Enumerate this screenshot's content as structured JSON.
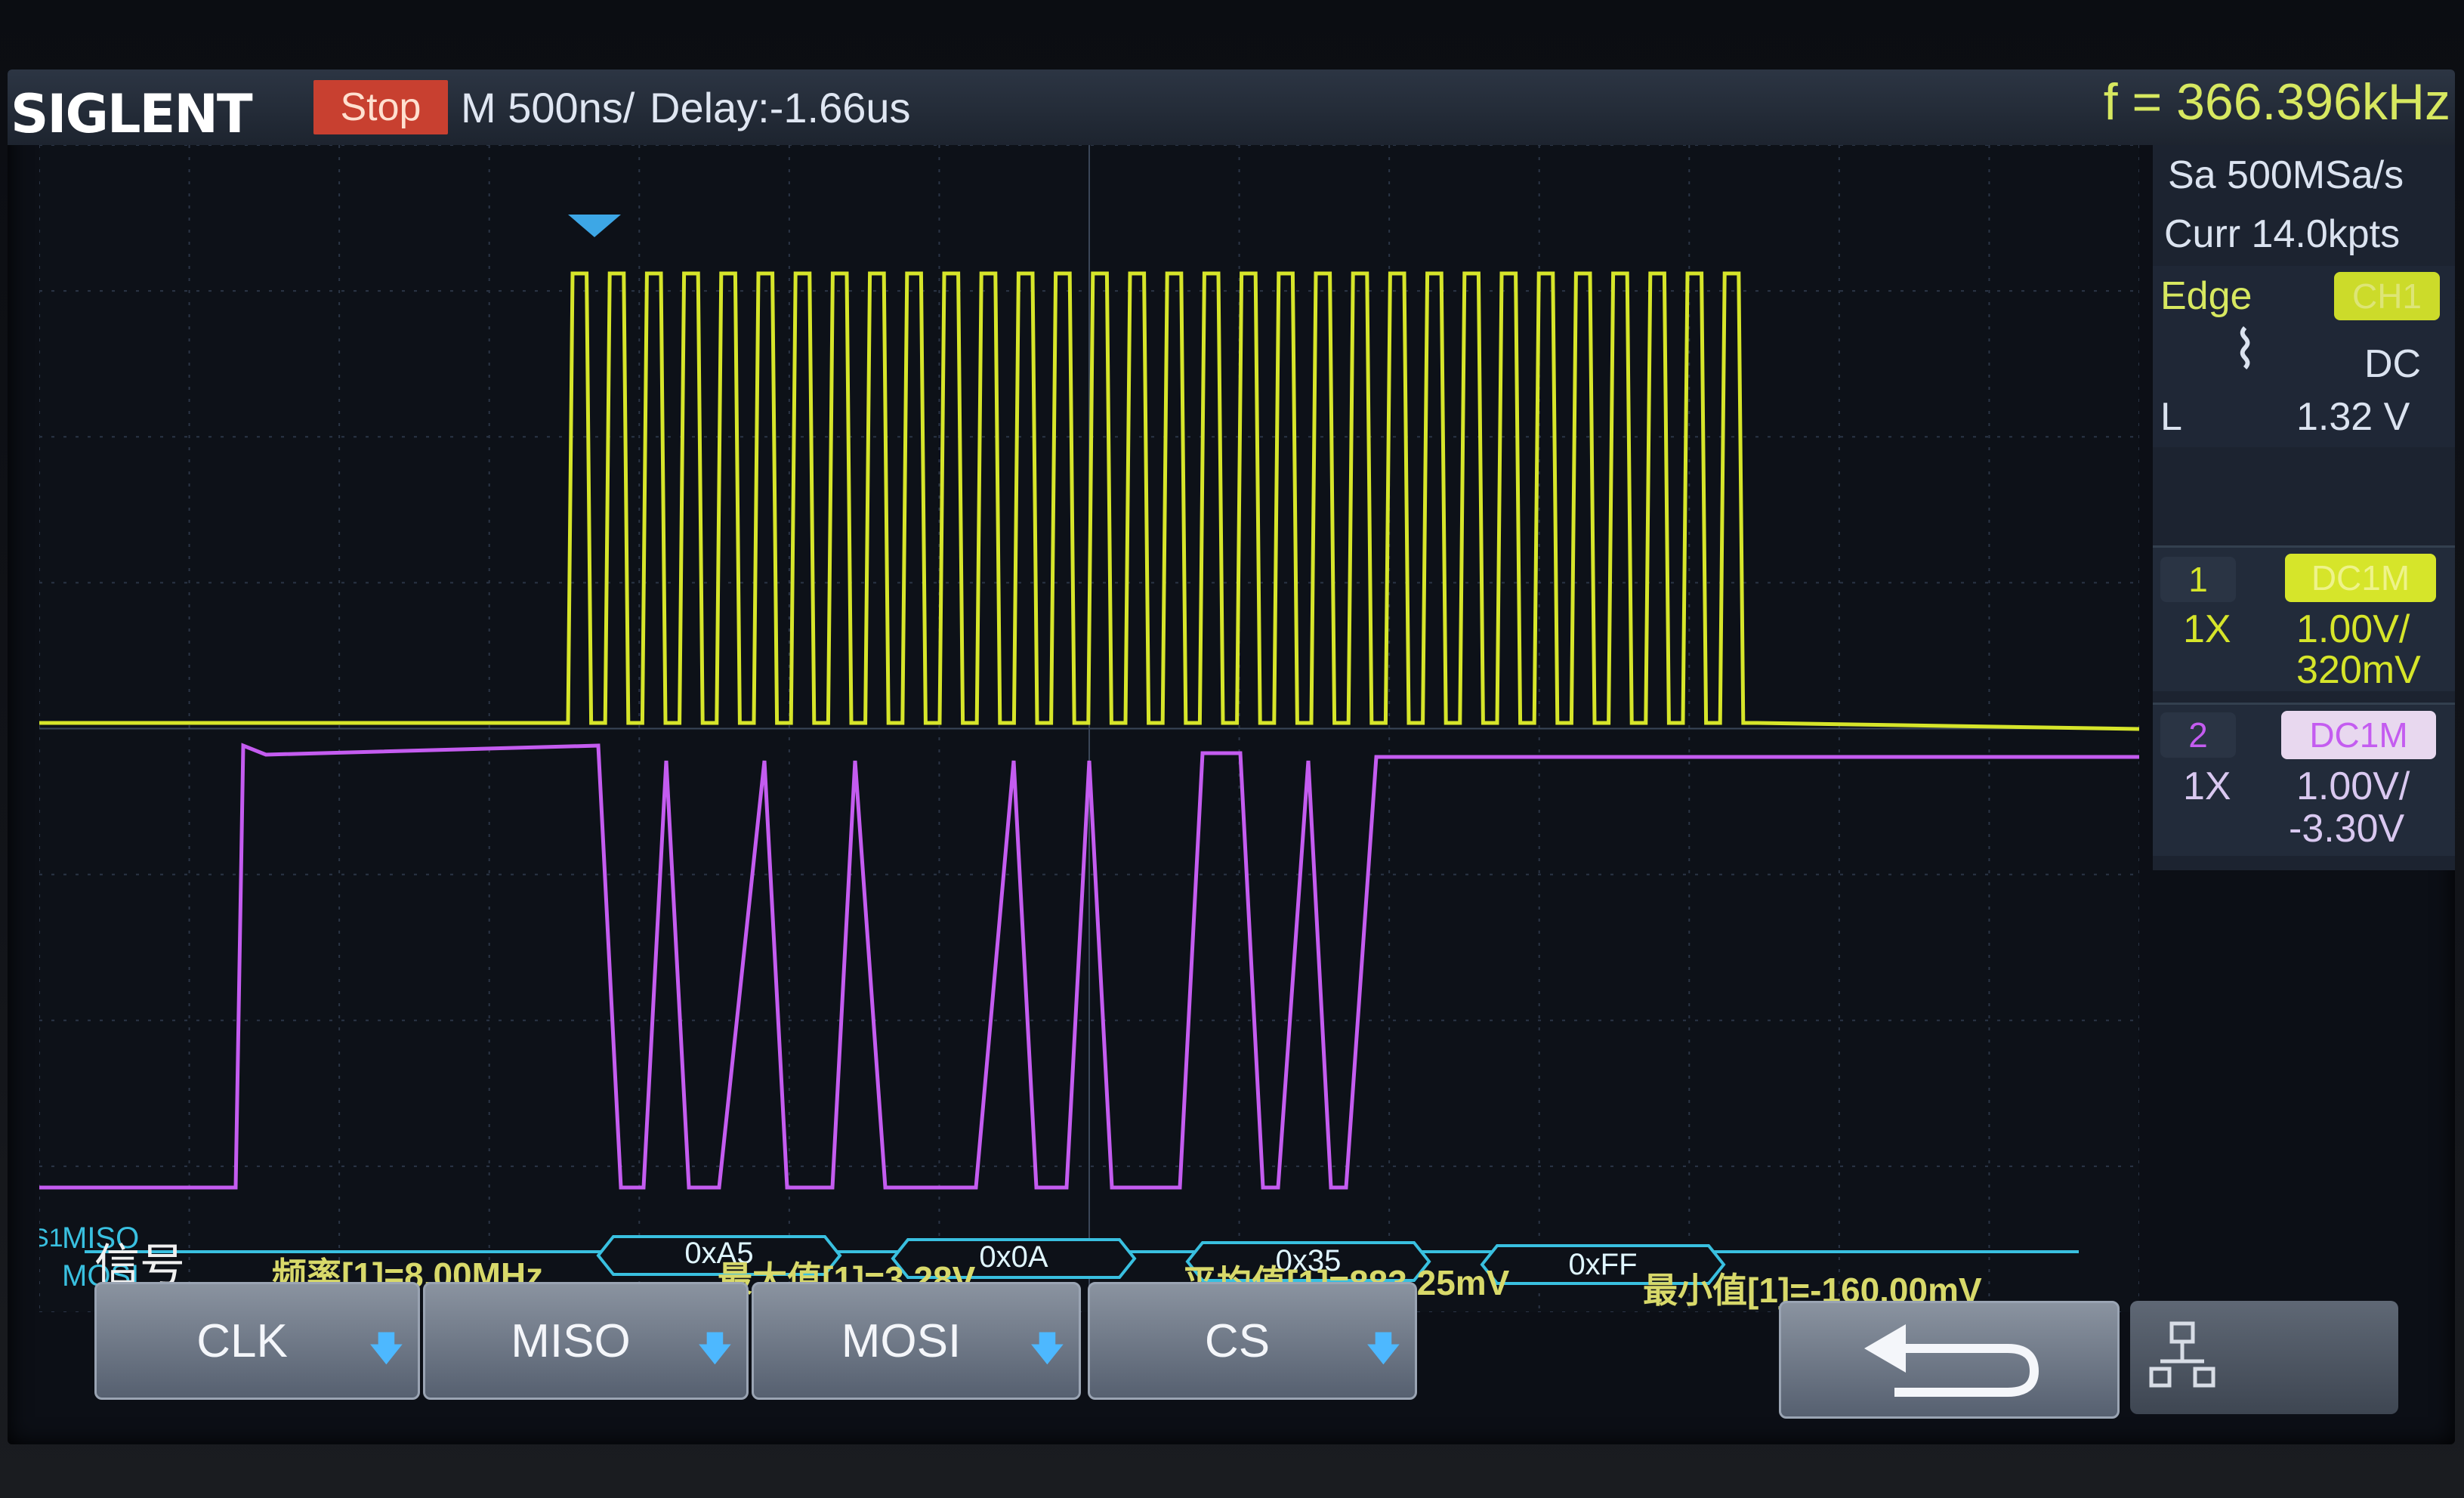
{
  "topbar": {
    "brand": "SIGLENT",
    "run_state": "Stop",
    "timebase": "M 500ns/",
    "delay": "Delay:-1.66us",
    "frequency": "f = 366.396kHz"
  },
  "acquisition": {
    "sample_rate": "Sa 500MSa/s",
    "curr_points": "Curr 14.0kpts"
  },
  "trigger": {
    "type": "Edge",
    "source": "CH1",
    "coupling": "DC",
    "level_label": "L",
    "level": "1.32 V",
    "slope_icon": "falling-edge-icon"
  },
  "channels": [
    {
      "number": "1",
      "coupling": "DC1M",
      "probe": "1X",
      "scale": "1.00V/",
      "offset": "320mV",
      "color": "#d6e52a"
    },
    {
      "number": "2",
      "coupling": "DC1M",
      "probe": "1X",
      "scale": "1.00V/",
      "offset": "-3.30V",
      "color": "#c45cf0"
    }
  ],
  "decode": {
    "bus_marker": "S1",
    "row_labels": [
      "MISO",
      "MOSI"
    ],
    "packets": [
      "0xA5",
      "0x0A",
      "0x35",
      "0xFF"
    ],
    "color": "#39c0e0"
  },
  "markers": {
    "ch1": "1",
    "ch2": "2"
  },
  "measurements": {
    "signal_label": "信号",
    "frequency": "频率[1]=8.00MHz",
    "max": "最大值[1]=3.28V",
    "mean": "平均值[1]=883.25mV",
    "min": "最小值[1]=-160.00mV"
  },
  "softkeys": [
    "CLK",
    "MISO",
    "MOSI",
    "CS"
  ],
  "icons": {
    "back": "return-arrow-icon",
    "network": "network-icon"
  }
}
